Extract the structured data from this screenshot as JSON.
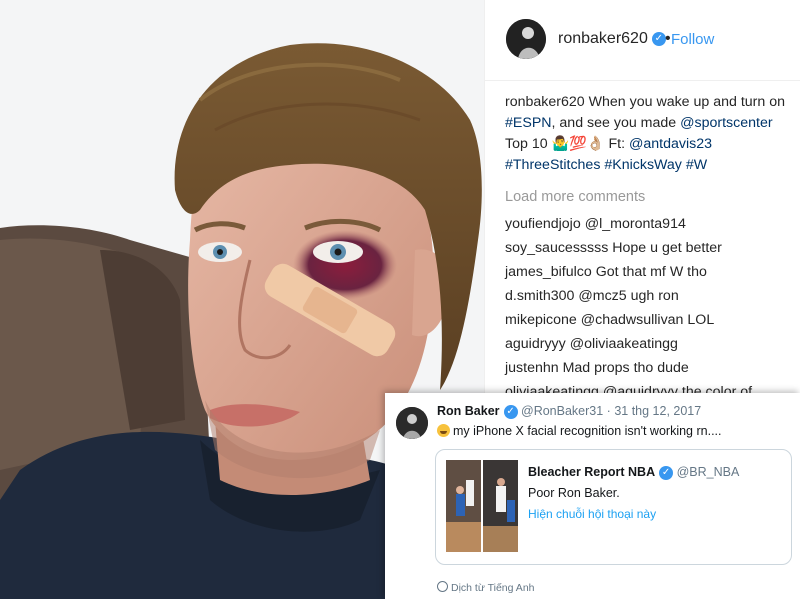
{
  "instagram": {
    "username": "ronbaker620",
    "verified_mark": "✓",
    "separator": "•",
    "follow_label": "Follow",
    "caption": {
      "username": "ronbaker620",
      "text_1": "When you wake up and turn on ",
      "hashtag_espn": "#ESPN",
      "text_2": ", and see you made ",
      "mention_sportscenter": "@sportscenter",
      "text_3": " Top 10 ",
      "emoji_text": "🤷‍♂️💯👌🏼",
      "text_4": " Ft: ",
      "mention_antdavis": "@antdavis23",
      "hashtag_threestitches": "#ThreeStitches",
      "hashtag_knicksway": "#KnicksWay",
      "hashtag_w": "#W"
    },
    "load_more_label": "Load more comments",
    "comments": [
      {
        "user": "youfiendjojo",
        "text": "@l_moronta914"
      },
      {
        "user": "soy_saucesssss",
        "text": "Hope u get better"
      },
      {
        "user": "james_bifulco",
        "text": "Got that mf W tho"
      },
      {
        "user": "d.smith300",
        "text": "@mcz5 ugh ron"
      },
      {
        "user": "mikepicone",
        "text": "@chadwsullivan LOL"
      },
      {
        "user": "aguidryyy",
        "text": "@oliviaakeatingg"
      },
      {
        "user": "justenhn",
        "text": "Mad props tho dude"
      },
      {
        "user": "oliviaakeatingg",
        "text": "@aguidryyy the color of"
      }
    ],
    "accent_color": "#3897f0"
  },
  "tweet": {
    "name": "Ron Baker",
    "verified_mark": "✓",
    "handle": "@RonBaker31",
    "separator": " · ",
    "date": "31 thg 12, 2017",
    "text": "my iPhone X facial recognition isn't working rn....",
    "emoji_icon": "joy-emoji",
    "quoted": {
      "name": "Bleacher Report NBA",
      "verified_mark": "✓",
      "handle": "@BR_NBA",
      "text": "Poor Ron Baker.",
      "show_thread": "Hiện chuỗi hội thoại này"
    },
    "translate_label": "Dịch từ Tiếng Anh",
    "link_color": "#1da1f2"
  }
}
